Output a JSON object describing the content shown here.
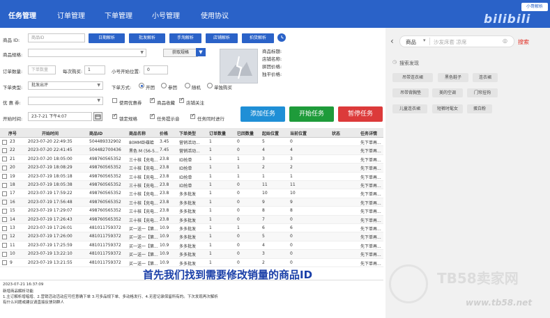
{
  "nav": {
    "items": [
      "任务管理",
      "订单管理",
      "下单管理",
      "小号管理",
      "使用协议"
    ],
    "active_index": 0
  },
  "logo": {
    "badge": "小哥解析",
    "text": "bilibili"
  },
  "form": {
    "product_id_label": "商品 ID:",
    "product_id_placeholder": "商品ID",
    "parse_buttons": [
      "日期解析",
      "批发解析",
      "手淘解析",
      "店铺解析",
      "拍货解析"
    ],
    "spec_label": "商品规格:",
    "fetch_spec_button": "获取规格",
    "order_qty_label": "订单数量:",
    "order_qty_placeholder": "下单数量",
    "per_buy_label": "每次购买:",
    "per_buy_value": "1",
    "small_start_label": "小号开始位置:",
    "small_start_value": "0",
    "order_type_label": "下单类型:",
    "order_type_value": "批发出评",
    "order_mode_label": "下单方式:",
    "order_mode_options": [
      "开团",
      "参团",
      "随机",
      "单独购买"
    ],
    "order_mode_selected": 0,
    "coupon_label": "优 惠 券:",
    "use_coupon_label": "使用优惠券",
    "fav_product_label": "商品收藏",
    "follow_shop_label": "店铺关注",
    "start_time_label": "开始时间:",
    "start_time_value": "23-7-21 下午4:07",
    "fixed_spec_label": "锁定规格",
    "task_remind_label": "任务提示音",
    "task_sync_label": "任务同时进行",
    "add_task": "添加任务",
    "start_task": "开始任务",
    "pause_task": "暂停任务",
    "info_labels": [
      "商品标题:",
      "店铺名称:",
      "拼团价格:",
      "独平价格:"
    ]
  },
  "table": {
    "headers": [
      "序号",
      "开始时间",
      "商品ID",
      "商品名称",
      "价格",
      "下单类型",
      "订单数量",
      "已回数量",
      "起始位置",
      "当前位置",
      "状态",
      "任务详情"
    ],
    "rows": [
      [
        "23",
        "2023-07-20 22:49:35",
        "504489332902",
        "80MM卧碟蛤",
        "3.45",
        "营销活动...",
        "1",
        "0",
        "5",
        "0",
        "",
        "先下单再..."
      ],
      [
        "22",
        "2023-07-20 22:41:45",
        "504482700436",
        "黑色 M (56-5...",
        "7.45",
        "营销活动...",
        "1",
        "0",
        "4",
        "4",
        "",
        "先下单再..."
      ],
      [
        "21",
        "2023-07-20 18:05:00",
        "498760565352",
        "三十核【充电...",
        "23.8",
        "ID抢单",
        "1",
        "1",
        "3",
        "3",
        "",
        "先下单再..."
      ],
      [
        "20",
        "2023-07-19 18:08:29",
        "498760565352",
        "三十核【充电...",
        "23.8",
        "ID抢单",
        "1",
        "1",
        "2",
        "2",
        "",
        "先下单再..."
      ],
      [
        "19",
        "2023-07-19 18:05:18",
        "498760565352",
        "三十核【充电...",
        "23.8",
        "ID抢单",
        "1",
        "1",
        "1",
        "1",
        "",
        "先下单再..."
      ],
      [
        "18",
        "2023-07-19 18:05:38",
        "498760565352",
        "三十核【充电...",
        "23.8",
        "ID抢单",
        "1",
        "0",
        "11",
        "11",
        "",
        "先下单再..."
      ],
      [
        "17",
        "2023-07-19 17:59:22",
        "498760565352",
        "三十核【充电...",
        "23.8",
        "多多批发",
        "1",
        "0",
        "10",
        "10",
        "",
        "先下单再..."
      ],
      [
        "16",
        "2023-07-19 17:56:48",
        "498760565352",
        "三十核【充电...",
        "23.8",
        "多多批发",
        "1",
        "0",
        "9",
        "9",
        "",
        "先下单再..."
      ],
      [
        "15",
        "2023-07-19 17:29:07",
        "498760565352",
        "三十核【充电...",
        "23.8",
        "多多批发",
        "1",
        "0",
        "8",
        "8",
        "",
        "先下单再..."
      ],
      [
        "14",
        "2023-07-19 17:26:43",
        "498760565352",
        "三十核【充电...",
        "23.8",
        "多多批发",
        "1",
        "0",
        "7",
        "0",
        "",
        "先下单再..."
      ],
      [
        "13",
        "2023-07-19 17:26:01",
        "481011759372",
        "买一送一【第...",
        "10.9",
        "多多批发",
        "1",
        "1",
        "6",
        "6",
        "",
        "先下单再..."
      ],
      [
        "12",
        "2023-07-19 17:26:00",
        "481011759372",
        "买一送一【第...",
        "10.9",
        "多多批发",
        "1",
        "0",
        "5",
        "0",
        "",
        "先下单再..."
      ],
      [
        "11",
        "2023-07-19 17:25:59",
        "481011759372",
        "买一送一【第...",
        "10.9",
        "多多批发",
        "1",
        "0",
        "4",
        "0",
        "",
        "先下单再..."
      ],
      [
        "10",
        "2023-07-19 13:22:10",
        "481011759372",
        "买一送一【第...",
        "10.9",
        "多多批发",
        "1",
        "0",
        "3",
        "0",
        "",
        "先下单再..."
      ],
      [
        "9",
        "2023-07-19 13:21:55",
        "481011759372",
        "买一送一【第...",
        "10.9",
        "多多批发",
        "1",
        "0",
        "2",
        "0",
        "",
        "先下单再..."
      ]
    ]
  },
  "log": {
    "lines": [
      "2023-07-21 16:37:09",
      "新增商品解析功能",
      "1.主订解析增暗增、2.营销活动活动应可任意确下单 3.可多品规下单、多动格发行、4.无密记录保留所有的。下次发现再次解析",
      "有什么问题或建议请直接反馈到群人"
    ]
  },
  "caption": "首先我们找到需要修改销量的商品ID",
  "right_panel": {
    "category": "商品",
    "search_placeholder": "沙发床套 凉席",
    "search_button": "搜索",
    "history_label": "搜索发现",
    "tags": [
      [
        "吊带连衣裙",
        "黑色鞋子",
        "连衣裙"
      ],
      [
        "吊带背胸垫",
        "美的空调",
        "门帘挂钩"
      ],
      [
        "儿童连衣裙",
        "短裤时髦女",
        "蛋白粉"
      ]
    ]
  },
  "watermark": {
    "main": "TB58卖家网",
    "url": "www.tb58.net"
  }
}
